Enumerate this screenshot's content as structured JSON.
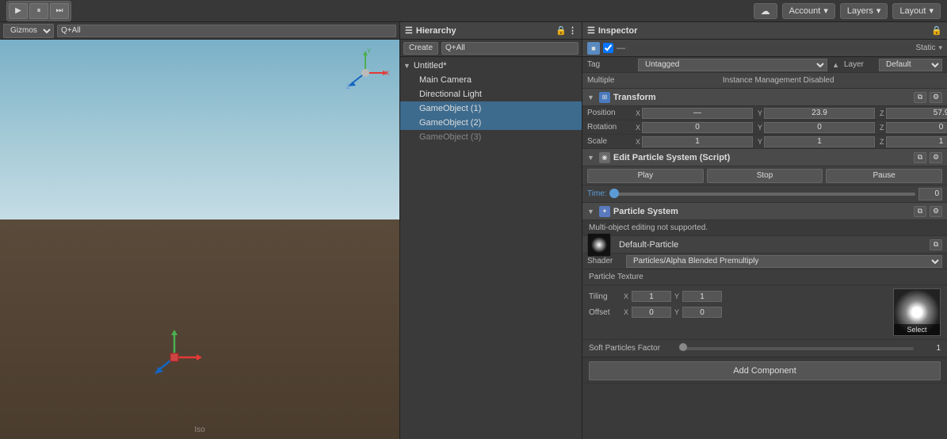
{
  "topbar": {
    "play_label": "▶",
    "pause_label": "⏸",
    "step_label": "⏭",
    "account_label": "Account",
    "layers_label": "Layers",
    "layout_label": "Layout"
  },
  "scene": {
    "gizmos_label": "Gizmos",
    "search_placeholder": "Q+All"
  },
  "hierarchy": {
    "title": "Hierarchy",
    "create_label": "Create",
    "search_placeholder": "Q+All",
    "items": [
      {
        "label": "Untitled*",
        "type": "scene",
        "indent": 0,
        "arrow": true
      },
      {
        "label": "Main Camera",
        "type": "object",
        "indent": 1
      },
      {
        "label": "Directional Light",
        "type": "object",
        "indent": 1
      },
      {
        "label": "GameObject (1)",
        "type": "object",
        "indent": 1,
        "selected": true
      },
      {
        "label": "GameObject (2)",
        "type": "object",
        "indent": 1,
        "selected": true
      },
      {
        "label": "GameObject (3)",
        "type": "object",
        "indent": 1,
        "grayed": true
      }
    ]
  },
  "inspector": {
    "title": "Inspector",
    "dash_label": "—",
    "static_label": "Static",
    "tag_label": "Tag",
    "tag_value": "Untagged",
    "layer_label": "Layer",
    "layer_value": "Default",
    "multiple_label": "Multiple",
    "instance_label": "Instance Management Disabled",
    "transform": {
      "title": "Transform",
      "position_label": "Position",
      "pos_x": "—",
      "pos_y": "23.9",
      "pos_z": "57.9",
      "rotation_label": "Rotation",
      "rot_x": "0",
      "rot_y": "0",
      "rot_z": "0",
      "scale_label": "Scale",
      "scale_x": "1",
      "scale_y": "1",
      "scale_z": "1"
    },
    "edit_particle": {
      "title": "Edit Particle System (Script)",
      "play_label": "Play",
      "stop_label": "Stop",
      "pause_label": "Pause",
      "time_label": "Time:",
      "time_value": "0"
    },
    "particle_system": {
      "title": "Particle System",
      "warning": "Multi-object editing not supported."
    },
    "default_particle": {
      "title": "Default-Particle",
      "shader_label": "Shader",
      "shader_value": "Particles/Alpha Blended Premultiply",
      "texture_label": "Particle Texture",
      "tiling_label": "Tiling",
      "tiling_x": "1",
      "tiling_y": "1",
      "offset_label": "Offset",
      "offset_x": "0",
      "offset_y": "0",
      "soft_label": "Soft Particles Factor",
      "soft_value": "1",
      "select_label": "Select"
    },
    "add_component_label": "Add Component"
  }
}
